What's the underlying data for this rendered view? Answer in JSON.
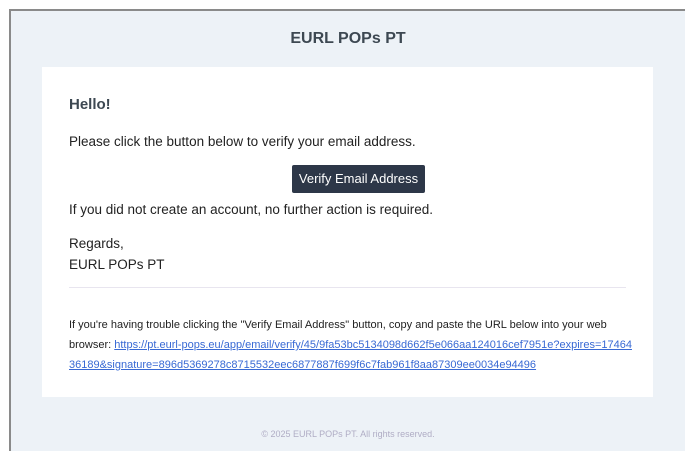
{
  "header": {
    "brand": "EURL POPs PT"
  },
  "body": {
    "greeting": "Hello!",
    "intro": "Please click the button below to verify your email address.",
    "button_label": "Verify Email Address",
    "outro": "If you did not create an account, no further action is required.",
    "salutation": "Regards,",
    "signature": "EURL POPs PT"
  },
  "subcopy": {
    "text": "If you're having trouble clicking the \"Verify Email Address\" button, copy and paste the URL below into your web browser: ",
    "link": "https://pt.eurl-pops.eu/app/email/verify/45/9fa53bc5134098d662f5e066aa124016cef7951e?expires=1746436189&signature=896d5369278c8715532eec6877887f699f6c7fab961f8aa87309ee0034e94496"
  },
  "footer": {
    "copyright": "© 2025 EURL POPs PT. All rights reserved."
  },
  "colors": {
    "page_bg": "#edf2f7",
    "card_bg": "#ffffff",
    "button_bg": "#2d3748",
    "link": "#3869d4"
  }
}
